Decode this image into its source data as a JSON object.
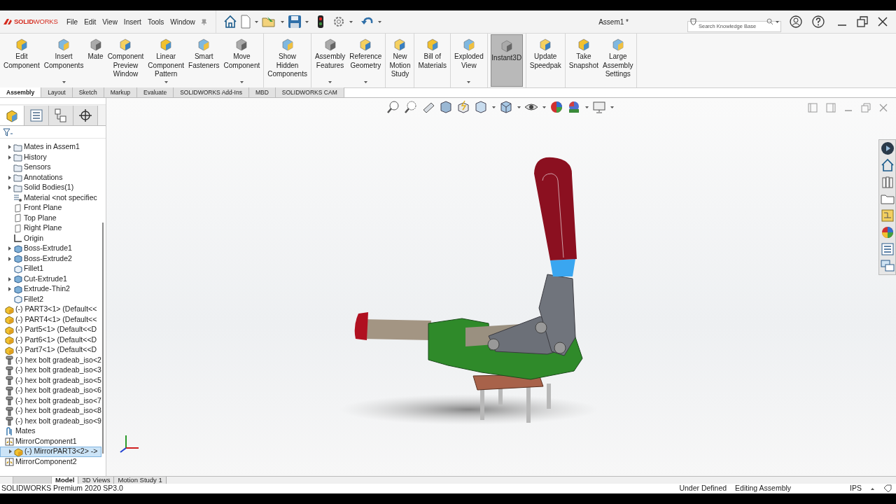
{
  "window": {
    "title": "Assem1 *"
  },
  "logo": "**SOLID**WORKS",
  "menu": [
    "File",
    "Edit",
    "View",
    "Insert",
    "Tools",
    "Window"
  ],
  "search": {
    "placeholder": "Search Knowledge Base"
  },
  "ribbon": {
    "groups": [
      [
        {
          "label": "Edit\nComponent",
          "dropdown": false,
          "selected": false
        },
        {
          "label": "Insert\nComponents",
          "dropdown": true,
          "selected": false
        },
        {
          "label": "Mate",
          "dropdown": false,
          "selected": false
        },
        {
          "label": "Component\nPreview\nWindow",
          "dropdown": false,
          "selected": false
        },
        {
          "label": "Linear\nComponent\nPattern",
          "dropdown": true,
          "selected": false
        },
        {
          "label": "Smart\nFasteners",
          "dropdown": false,
          "selected": false
        },
        {
          "label": "Move\nComponent",
          "dropdown": true,
          "selected": false
        }
      ],
      [
        {
          "label": "Show\nHidden\nComponents",
          "dropdown": false,
          "selected": false
        }
      ],
      [
        {
          "label": "Assembly\nFeatures",
          "dropdown": true,
          "selected": false
        },
        {
          "label": "Reference\nGeometry",
          "dropdown": true,
          "selected": false
        }
      ],
      [
        {
          "label": "New\nMotion\nStudy",
          "dropdown": false,
          "selected": false
        }
      ],
      [
        {
          "label": "Bill of\nMaterials",
          "dropdown": false,
          "selected": false
        }
      ],
      [
        {
          "label": "Exploded\nView",
          "dropdown": true,
          "selected": false
        }
      ],
      [
        {
          "label": "Instant3D",
          "dropdown": false,
          "selected": true
        }
      ],
      [
        {
          "label": "Update\nSpeedpak",
          "dropdown": false,
          "selected": false
        }
      ],
      [
        {
          "label": "Take\nSnapshot",
          "dropdown": false,
          "selected": false
        },
        {
          "label": "Large\nAssembly\nSettings",
          "dropdown": false,
          "selected": false
        }
      ]
    ]
  },
  "command_tabs": [
    {
      "label": "Assembly",
      "selected": true
    },
    {
      "label": "Layout",
      "selected": false
    },
    {
      "label": "Sketch",
      "selected": false
    },
    {
      "label": "Markup",
      "selected": false
    },
    {
      "label": "Evaluate",
      "selected": false
    },
    {
      "label": "SOLIDWORKS Add-Ins",
      "selected": false
    },
    {
      "label": "MBD",
      "selected": false
    },
    {
      "label": "SOLIDWORKS CAM",
      "selected": false
    }
  ],
  "tree": {
    "continued_children": [
      {
        "label": "Mates in Assem1",
        "kind": "folder",
        "expandable": true,
        "selected": false
      },
      {
        "label": "History",
        "kind": "folder",
        "expandable": true,
        "selected": false
      },
      {
        "label": "Sensors",
        "kind": "folder",
        "expandable": false,
        "selected": false
      },
      {
        "label": "Annotations",
        "kind": "folder",
        "expandable": true,
        "selected": false
      },
      {
        "label": "Solid Bodies(1)",
        "kind": "folder",
        "expandable": true,
        "selected": false
      },
      {
        "label": "Material <not specifiec",
        "kind": "material",
        "expandable": false,
        "selected": false
      },
      {
        "label": "Front Plane",
        "kind": "plane",
        "expandable": false,
        "selected": false
      },
      {
        "label": "Top Plane",
        "kind": "plane",
        "expandable": false,
        "selected": false
      },
      {
        "label": "Right Plane",
        "kind": "plane",
        "expandable": false,
        "selected": false
      },
      {
        "label": "Origin",
        "kind": "origin",
        "expandable": false,
        "selected": false
      },
      {
        "label": "Boss-Extrude1",
        "kind": "feature",
        "expandable": true,
        "selected": false
      },
      {
        "label": "Boss-Extrude2",
        "kind": "feature",
        "expandable": true,
        "selected": false
      },
      {
        "label": "Fillet1",
        "kind": "fillet",
        "expandable": false,
        "selected": false
      },
      {
        "label": "Cut-Extrude1",
        "kind": "feature",
        "expandable": true,
        "selected": false
      },
      {
        "label": "Extrude-Thin2",
        "kind": "feature",
        "expandable": true,
        "selected": false
      },
      {
        "label": "Fillet2",
        "kind": "fillet",
        "expandable": false,
        "selected": false
      }
    ],
    "items": [
      {
        "label": "(-) PART3<1> (Default<<",
        "kind": "part",
        "expandable": false,
        "selected": false
      },
      {
        "label": "(-) PART4<1> (Default<<",
        "kind": "part",
        "expandable": false,
        "selected": false
      },
      {
        "label": "(-) Part5<1> (Default<<D",
        "kind": "part",
        "expandable": false,
        "selected": false
      },
      {
        "label": "(-) Part6<1> (Default<<D",
        "kind": "part",
        "expandable": false,
        "selected": false
      },
      {
        "label": "(-) Part7<1> (Default<<D",
        "kind": "part",
        "expandable": false,
        "selected": false
      },
      {
        "label": "(-) hex bolt gradeab_iso<2",
        "kind": "bolt",
        "expandable": false,
        "selected": false
      },
      {
        "label": "(-) hex bolt gradeab_iso<3",
        "kind": "bolt",
        "expandable": false,
        "selected": false
      },
      {
        "label": "(-) hex bolt gradeab_iso<5",
        "kind": "bolt",
        "expandable": false,
        "selected": false
      },
      {
        "label": "(-) hex bolt gradeab_iso<6",
        "kind": "bolt",
        "expandable": false,
        "selected": false
      },
      {
        "label": "(-) hex bolt gradeab_iso<7",
        "kind": "bolt",
        "expandable": false,
        "selected": false
      },
      {
        "label": "(-) hex bolt gradeab_iso<8",
        "kind": "bolt",
        "expandable": false,
        "selected": false
      },
      {
        "label": "(-) hex bolt gradeab_iso<9",
        "kind": "bolt",
        "expandable": false,
        "selected": false
      },
      {
        "label": "Mates",
        "kind": "mates",
        "expandable": false,
        "selected": false
      },
      {
        "label": "MirrorComponent1",
        "kind": "mirror",
        "expandable": false,
        "selected": false,
        "children": [
          {
            "label": "(-) MirrorPART3<2> ->",
            "kind": "part",
            "expandable": true,
            "selected": true
          }
        ]
      },
      {
        "label": "MirrorComponent2",
        "kind": "mirror",
        "expandable": false,
        "selected": false
      }
    ]
  },
  "bottom_tabs": [
    {
      "label": "Model",
      "selected": true
    },
    {
      "label": "3D Views",
      "selected": false
    },
    {
      "label": "Motion Study 1",
      "selected": false
    }
  ],
  "status_bar": {
    "product": "SOLIDWORKS Premium 2020 SP3.0",
    "state": "Under Defined",
    "mode": "Editing Assembly",
    "units": "IPS"
  }
}
